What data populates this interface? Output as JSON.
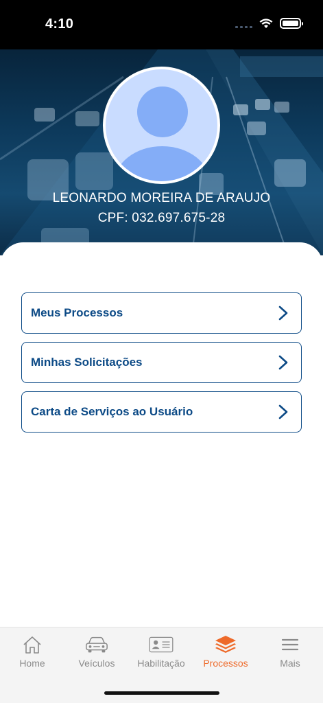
{
  "status_bar": {
    "time": "4:10"
  },
  "profile": {
    "name": "LEONARDO MOREIRA DE ARAUJO",
    "cpf": "CPF: 032.697.675-28"
  },
  "menu": [
    {
      "label": "Meus Processos",
      "icon": "chevron-right-icon"
    },
    {
      "label": "Minhas Solicitações",
      "icon": "chevron-right-icon"
    },
    {
      "label": "Carta de Serviços ao Usuário",
      "icon": "chevron-right-icon"
    }
  ],
  "tabs": [
    {
      "label": "Home",
      "icon": "home-icon",
      "active": false
    },
    {
      "label": "Veículos",
      "icon": "car-icon",
      "active": false
    },
    {
      "label": "Habilitação",
      "icon": "id-card-icon",
      "active": false
    },
    {
      "label": "Processos",
      "icon": "layers-icon",
      "active": true
    },
    {
      "label": "Mais",
      "icon": "menu-icon",
      "active": false
    }
  ],
  "colors": {
    "primary": "#0c4a86",
    "active_tab": "#ee6a2a",
    "inactive_tab": "#8a8a8a",
    "avatar_bg": "#c9dcff",
    "avatar_fg": "#84adf7"
  }
}
